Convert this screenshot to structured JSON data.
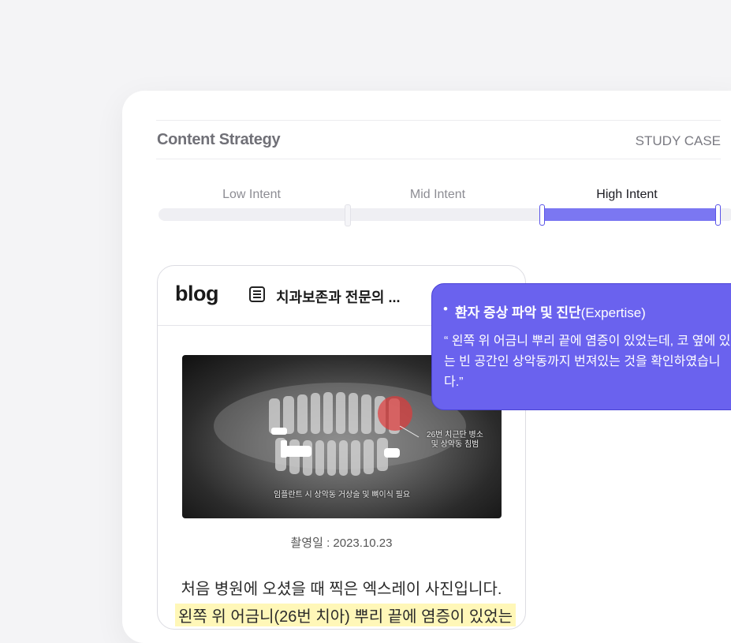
{
  "header": {
    "title": "Content Strategy",
    "tag": "STUDY CASE"
  },
  "intent": {
    "labels": [
      "Low Intent",
      "Mid Intent",
      "High Intent"
    ],
    "active": "High Intent"
  },
  "blog": {
    "logo": "blog",
    "category": "치과보존과 전문의 ...",
    "xray_notes": {
      "tooth": "26번 치근단 병소\n및 상악동 침범",
      "implant": "임플란트 시 상악동 거상술 및 뼈이식 필요"
    },
    "caption": "촬영일 : 2023.10.23",
    "body_line1": "처음 병원에 오셨을 때 찍은 엑스레이 사진입니다.",
    "body_line2": "왼쪽 위 어금니(26번 치아) 뿌리 끝에 염증이 있었는"
  },
  "tooltip": {
    "bullet": "•",
    "title_bold": "환자 증상 파악 및 진단",
    "title_rest": "(Expertise)",
    "quote": "“ 왼쪽 위 어금니 뿌리 끝에 염증이 있었는데, 코 옆에 있는 빈 공간인 상악동까지 번져있는 것을 확인하였습니다.”"
  },
  "colors": {
    "accent": "#6a62ee",
    "track_fill": "#7b77f2",
    "highlight": "#fff7b8"
  },
  "icons": {
    "category": "list-icon"
  }
}
